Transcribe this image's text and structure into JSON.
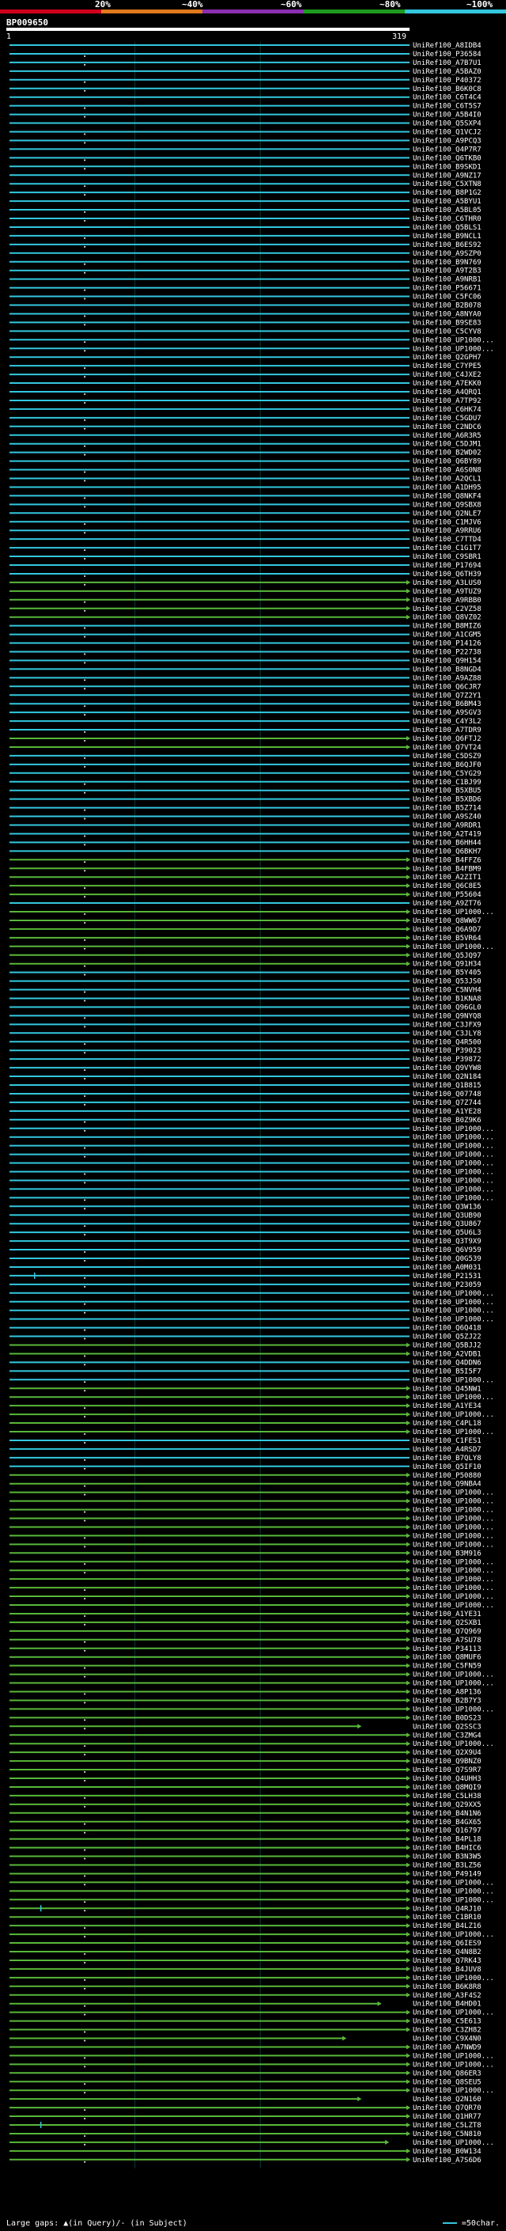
{
  "scale": {
    "labels": [
      "20%",
      "~40%",
      "~60%",
      "~80%",
      "~100%"
    ],
    "colors": [
      "#d0021b",
      "#e0781c",
      "#8a2fb0",
      "#1e9a1e",
      "#33c8e0"
    ]
  },
  "query": {
    "id": "BP009650",
    "start": "1",
    "end": "319"
  },
  "footer": {
    "legend": "Large gaps: ▲(in Query)/- (in Subject)",
    "scale_note": "=50char."
  },
  "chart_data": {
    "type": "alignment-overview",
    "query_length": 319,
    "identity_colors": {
      "high": "#33c8e0",
      "mid": "#58b83a"
    },
    "hit_labels": [
      "UniRef100_A8IDB4",
      "UniRef100_P36584",
      "UniRef100_A7B7U1",
      "UniRef100_A5BAZ0",
      "UniRef100_P40372",
      "UniRef100_B6K0C8",
      "UniRef100_C6T4C4",
      "UniRef100_C6T5S7",
      "UniRef100_A5B4I0",
      "UniRef100_Q5SXP4",
      "UniRef100_Q1VCJ2",
      "UniRef100_A9PCQ3",
      "UniRef100_Q4P7R7",
      "UniRef100_Q6TKB0",
      "UniRef100_B9SKD1",
      "UniRef100_A9NZ17",
      "UniRef100_C5XTN8",
      "UniRef100_B8P1G2",
      "UniRef100_A5BYU1",
      "UniRef100_A5BL05",
      "UniRef100_C6THR0",
      "UniRef100_Q5BLS1",
      "UniRef100_B9NCL1",
      "UniRef100_B6ES92",
      "UniRef100_A9SZP0",
      "UniRef100_B9N769",
      "UniRef100_A9T2B3",
      "UniRef100_A9NRB1",
      "UniRef100_P56671",
      "UniRef100_C5FC06",
      "UniRef100_B2B078",
      "UniRef100_A8NYA0",
      "UniRef100_B9SE83",
      "UniRef100_C5CYV8",
      "UniRef100_UP1000...",
      "UniRef100_UP1000...",
      "UniRef100_Q2GPH7",
      "UniRef100_C7YPE5",
      "UniRef100_C4JXE2",
      "UniRef100_A7EKK0",
      "UniRef100_A4QRQ1",
      "UniRef100_A7TP92",
      "UniRef100_C6HK74",
      "UniRef100_C5GDU7",
      "UniRef100_C2NDC6",
      "UniRef100_A6R3R5",
      "UniRef100_C5DJM1",
      "UniRef100_B2WD02",
      "UniRef100_Q6BY89",
      "UniRef100_A6S0N8",
      "UniRef100_A2QCL1",
      "UniRef100_A1DH95",
      "UniRef100_Q8NKF4",
      "UniRef100_Q9SBX8",
      "UniRef100_Q2NLE7",
      "UniRef100_C1MJV6",
      "UniRef100_A9RRU6",
      "UniRef100_C7TTD4",
      "UniRef100_C1G1T7",
      "UniRef100_C9SBR1",
      "UniRef100_P17694",
      "UniRef100_Q6TH39",
      "UniRef100_A3LUS0",
      "UniRef100_A9TUZ9",
      "UniRef100_A9RBB0",
      "UniRef100_C2VZ58",
      "UniRef100_Q8VZ02",
      "UniRef100_B8MIZ6",
      "UniRef100_A1CGM5",
      "UniRef100_P14126",
      "UniRef100_P22738",
      "UniRef100_Q9H154",
      "UniRef100_B8NGD4",
      "UniRef100_A9AZ88",
      "UniRef100_Q6CJR7",
      "UniRef100_Q7Z2Y1",
      "UniRef100_B6BM43",
      "UniRef100_A9SGV3",
      "UniRef100_C4Y3L2",
      "UniRef100_A7TDR9",
      "UniRef100_Q6FTJ2",
      "UniRef100_Q7VT24",
      "UniRef100_C5DSZ9",
      "UniRef100_B6QJF0",
      "UniRef100_C5YG29",
      "UniRef100_C1BJ99",
      "UniRef100_B5XBU5",
      "UniRef100_B5XBD6",
      "UniRef100_B5Z714",
      "UniRef100_A9SZ40",
      "UniRef100_A9RDR1",
      "UniRef100_A2T419",
      "UniRef100_B6HH44",
      "UniRef100_Q6BKH7",
      "UniRef100_B4FFZ6",
      "UniRef100_B4FBM9",
      "UniRef100_A2ZIT1",
      "UniRef100_Q6C8E5",
      "UniRef100_P55604",
      "UniRef100_A9ZT76",
      "UniRef100_UP1000...",
      "UniRef100_Q8WW67",
      "UniRef100_Q6A9D7",
      "UniRef100_B5VR64",
      "UniRef100_UP1000...",
      "UniRef100_Q5JQ97",
      "UniRef100_Q91H34",
      "UniRef100_B5Y405",
      "UniRef100_Q53JS0",
      "UniRef100_C5NVH4",
      "UniRef100_B1KNA8",
      "UniRef100_Q96GL0",
      "UniRef100_Q9NYQ8",
      "UniRef100_C3JFX9",
      "UniRef100_C3JLY8",
      "UniRef100_Q4R500",
      "UniRef100_P39023",
      "UniRef100_P39872",
      "UniRef100_Q9VYW8",
      "UniRef100_Q2N184",
      "UniRef100_Q1B815",
      "UniRef100_Q07748",
      "UniRef100_Q7Z744",
      "UniRef100_A1YE28",
      "UniRef100_B0Z9K6",
      "UniRef100_UP1000...",
      "UniRef100_UP1000...",
      "UniRef100_UP1000...",
      "UniRef100_UP1000...",
      "UniRef100_UP1000...",
      "UniRef100_UP1000...",
      "UniRef100_UP1000...",
      "UniRef100_UP1000...",
      "UniRef100_UP1000...",
      "UniRef100_Q3W136",
      "UniRef100_Q3UB90",
      "UniRef100_Q3U867",
      "UniRef100_Q5U6L3",
      "UniRef100_Q3T9X9",
      "UniRef100_Q6V959",
      "UniRef100_Q0G539",
      "UniRef100_A0M031",
      "UniRef100_P21531",
      "UniRef100_P23059",
      "UniRef100_UP1000...",
      "UniRef100_UP1000...",
      "UniRef100_UP1000...",
      "UniRef100_UP1000...",
      "UniRef100_Q6Q418",
      "UniRef100_Q5ZJ22",
      "UniRef100_Q5BJJ2",
      "UniRef100_A2VDB1",
      "UniRef100_Q4DDN6",
      "UniRef100_B5I5F7",
      "UniRef100_UP1000...",
      "UniRef100_Q45NW1",
      "UniRef100_UP1000...",
      "UniRef100_A1YE34",
      "UniRef100_UP1000...",
      "UniRef100_C4PL18",
      "UniRef100_UP1000...",
      "UniRef100_C1FES1",
      "UniRef100_A4RSD7",
      "UniRef100_B7QLY8",
      "UniRef100_Q5IF10",
      "UniRef100_P50880",
      "UniRef100_Q9NBA4",
      "UniRef100_UP1000...",
      "UniRef100_UP1000...",
      "UniRef100_UP1000...",
      "UniRef100_UP1000...",
      "UniRef100_UP1000...",
      "UniRef100_UP1000...",
      "UniRef100_UP1000...",
      "UniRef100_B3M916",
      "UniRef100_UP1000...",
      "UniRef100_UP1000...",
      "UniRef100_UP1000...",
      "UniRef100_UP1000...",
      "UniRef100_UP1000...",
      "UniRef100_UP1000...",
      "UniRef100_A1YE31",
      "UniRef100_Q2SXB1",
      "UniRef100_Q7Q969",
      "UniRef100_A7SU78",
      "UniRef100_P34113",
      "UniRef100_Q8MUF6",
      "UniRef100_C5FN59",
      "UniRef100_UP1000...",
      "UniRef100_UP1000...",
      "UniRef100_A8P136",
      "UniRef100_B2B7Y3",
      "UniRef100_UP1000...",
      "UniRef100_B0DS23",
      "UniRef100_Q2SSC3",
      "UniRef100_C3ZMG4",
      "UniRef100_UP1000...",
      "UniRef100_Q2X9U4",
      "UniRef100_Q9BNZ0",
      "UniRef100_Q7S9R7",
      "UniRef100_Q4UHH3",
      "UniRef100_Q8MQI9",
      "UniRef100_C5LH38",
      "UniRef100_Q29XX5",
      "UniRef100_B4N1N6",
      "UniRef100_B4GX65",
      "UniRef100_Q16797",
      "UniRef100_B4PL18",
      "UniRef100_B4HIC6",
      "UniRef100_B3N3W5",
      "UniRef100_B3LZ56",
      "UniRef100_P49149",
      "UniRef100_UP1000...",
      "UniRef100_UP1000...",
      "UniRef100_UP1000...",
      "UniRef100_Q4RJ10",
      "UniRef100_C1BR10",
      "UniRef100_B4LZ16",
      "UniRef100_UP1000...",
      "UniRef100_Q6IES9",
      "UniRef100_Q4N8B2",
      "UniRef100_Q7RK43",
      "UniRef100_B4JUV8",
      "UniRef100_UP1000...",
      "UniRef100_B6K8R8",
      "UniRef100_A3F4S2",
      "UniRef100_B4HD01",
      "UniRef100_UP1000...",
      "UniRef100_C5E613",
      "UniRef100_C3ZH82",
      "UniRef100_C9X4N0",
      "UniRef100_A7NWD9",
      "UniRef100_UP1000...",
      "UniRef100_UP1000...",
      "UniRef100_Q86ER3",
      "UniRef100_Q8SEU5",
      "UniRef100_UP1000...",
      "UniRef100_Q2N160",
      "UniRef100_Q7QR70",
      "UniRef100_Q1HR77",
      "UniRef100_C5LZT8",
      "UniRef100_C5N810",
      "UniRef100_UP1000...",
      "UniRef100_B0W134",
      "UniRef100_A7S6D6"
    ],
    "mid_identity_hits": [
      62,
      63,
      64,
      65,
      66,
      80,
      81,
      94,
      95,
      96,
      97,
      98,
      100,
      101,
      102,
      103,
      104,
      105,
      106,
      150,
      151,
      155,
      156,
      157,
      158,
      159,
      160,
      165,
      166,
      167,
      168,
      169,
      170,
      171,
      172,
      173,
      174,
      175,
      176,
      177,
      178,
      179,
      180,
      181,
      182,
      183,
      184,
      185,
      186,
      187,
      188,
      189,
      190,
      191,
      192,
      193,
      194,
      195,
      196,
      197,
      198,
      199,
      200,
      201,
      202,
      203,
      204,
      205,
      206,
      207,
      208,
      209,
      210,
      211,
      212,
      213,
      214,
      215,
      216,
      217,
      218,
      219,
      220,
      221,
      222,
      223,
      224,
      225,
      226,
      227,
      228,
      229,
      230,
      231,
      232,
      233,
      234,
      235,
      236,
      237,
      238,
      239,
      240,
      241,
      242,
      243,
      244,
      245,
      246,
      247,
      248,
      249,
      250,
      251,
      252,
      253,
      254
    ],
    "truncated_hits": [
      {
        "index": 194,
        "end": 280
      },
      {
        "index": 226,
        "end": 296
      },
      {
        "index": 230,
        "end": 268
      },
      {
        "index": 237,
        "end": 280
      },
      {
        "index": 242,
        "end": 302
      },
      {
        "index": 245,
        "end": 268
      },
      {
        "index": 246,
        "end": 268
      },
      {
        "index": 254,
        "end": 280
      }
    ],
    "gap_markers": [
      {
        "index": 142,
        "pos": 20
      },
      {
        "index": 215,
        "pos": 25
      },
      {
        "index": 240,
        "pos": 25
      }
    ]
  }
}
